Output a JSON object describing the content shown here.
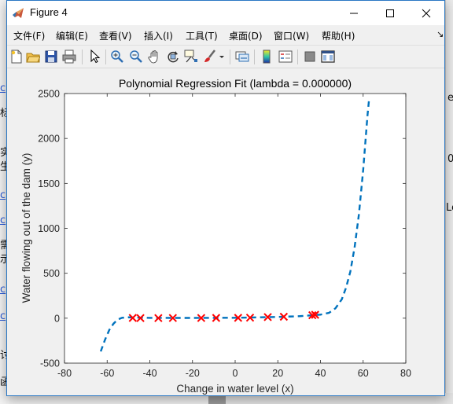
{
  "window": {
    "title": "Figure 4",
    "minimize_glyph": "—",
    "maximize_glyph": "☐",
    "close_glyph": "✕"
  },
  "menu": {
    "items": [
      {
        "label": "文件(F)"
      },
      {
        "label": "编辑(E)"
      },
      {
        "label": "查看(V)"
      },
      {
        "label": "插入(I)"
      },
      {
        "label": "工具(T)"
      },
      {
        "label": "桌面(D)"
      },
      {
        "label": "窗口(W)"
      },
      {
        "label": "帮助(H)"
      }
    ],
    "overflow_glyph": "↘"
  },
  "toolbar": {
    "buttons": [
      {
        "name": "new-figure-icon"
      },
      {
        "name": "open-file-icon"
      },
      {
        "name": "save-icon"
      },
      {
        "name": "print-icon"
      },
      {
        "name": "edit-plot-arrow-icon"
      },
      {
        "name": "zoom-in-icon"
      },
      {
        "name": "zoom-out-icon"
      },
      {
        "name": "pan-hand-icon"
      },
      {
        "name": "rotate-3d-icon"
      },
      {
        "name": "data-cursor-icon"
      },
      {
        "name": "brush-icon"
      },
      {
        "name": "link-plot-icon"
      },
      {
        "name": "colorbar-icon"
      },
      {
        "name": "legend-icon"
      },
      {
        "name": "hide-plot-tools-icon"
      },
      {
        "name": "show-plot-tools-icon"
      }
    ]
  },
  "background": {
    "left_fragments": [
      "c",
      "标",
      "实",
      "生",
      "c",
      "c",
      "需",
      "示",
      "c",
      "c",
      "讨",
      "函"
    ],
    "right_fragments": [
      "e",
      "0",
      "Le"
    ]
  },
  "chart_data": {
    "type": "line",
    "title": "Polynomial Regression Fit (lambda = 0.000000)",
    "xlabel": "Change in water level (x)",
    "ylabel": "Water flowing out of the dam (y)",
    "xlim": [
      -80,
      80
    ],
    "ylim": [
      -500,
      2500
    ],
    "xticks": [
      -80,
      -60,
      -40,
      -20,
      0,
      20,
      40,
      60,
      80
    ],
    "yticks": [
      -500,
      0,
      500,
      1000,
      1500,
      2000,
      2500
    ],
    "grid": false,
    "series": [
      {
        "kind": "scatter",
        "marker": "x",
        "color": "#ff0000",
        "points": [
          {
            "x": -48,
            "y": 3
          },
          {
            "x": -44.4,
            "y": 1
          },
          {
            "x": -36,
            "y": 1
          },
          {
            "x": -29.2,
            "y": 2
          },
          {
            "x": -15.9,
            "y": 2
          },
          {
            "x": -8.9,
            "y": 3
          },
          {
            "x": 1.4,
            "y": 4
          },
          {
            "x": 7,
            "y": 6
          },
          {
            "x": 15.3,
            "y": 12
          },
          {
            "x": 22.8,
            "y": 16
          },
          {
            "x": 36.2,
            "y": 33
          },
          {
            "x": 37.5,
            "y": 38
          }
        ]
      },
      {
        "kind": "line",
        "style": "dashed",
        "color": "#0072bd",
        "points": [
          {
            "x": -63,
            "y": -370
          },
          {
            "x": -61,
            "y": -240
          },
          {
            "x": -59,
            "y": -130
          },
          {
            "x": -57,
            "y": -60
          },
          {
            "x": -55,
            "y": -15
          },
          {
            "x": -53,
            "y": 5
          },
          {
            "x": -50,
            "y": 10
          },
          {
            "x": -45,
            "y": 6
          },
          {
            "x": -40,
            "y": 4
          },
          {
            "x": -30,
            "y": 3
          },
          {
            "x": -20,
            "y": 3
          },
          {
            "x": -10,
            "y": 4
          },
          {
            "x": 0,
            "y": 5
          },
          {
            "x": 10,
            "y": 9
          },
          {
            "x": 20,
            "y": 14
          },
          {
            "x": 30,
            "y": 22
          },
          {
            "x": 36,
            "y": 32
          },
          {
            "x": 40,
            "y": 40
          },
          {
            "x": 44,
            "y": 60
          },
          {
            "x": 47,
            "y": 110
          },
          {
            "x": 50,
            "y": 210
          },
          {
            "x": 52,
            "y": 340
          },
          {
            "x": 54,
            "y": 520
          },
          {
            "x": 56,
            "y": 790
          },
          {
            "x": 58,
            "y": 1150
          },
          {
            "x": 60,
            "y": 1650
          },
          {
            "x": 62,
            "y": 2250
          },
          {
            "x": 62.7,
            "y": 2420
          }
        ]
      }
    ]
  }
}
